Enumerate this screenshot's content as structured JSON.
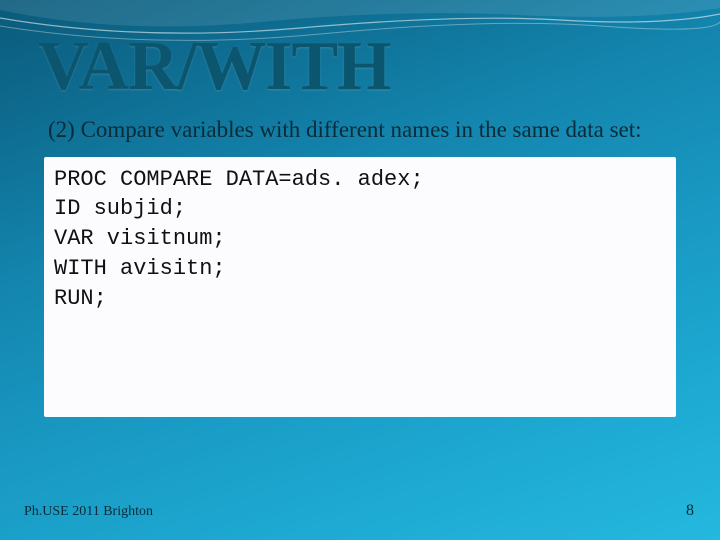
{
  "title": "VAR/WITH",
  "subtitle": "(2) Compare variables with different names in the same data set:",
  "code": {
    "line1": "PROC COMPARE DATA=ads. adex;",
    "line2": "ID subjid;",
    "line3": "VAR visitnum;",
    "line4": "WITH avisitn;",
    "line5": "RUN;"
  },
  "footer_left": "Ph.USE 2011 Brighton",
  "footer_right": "8"
}
